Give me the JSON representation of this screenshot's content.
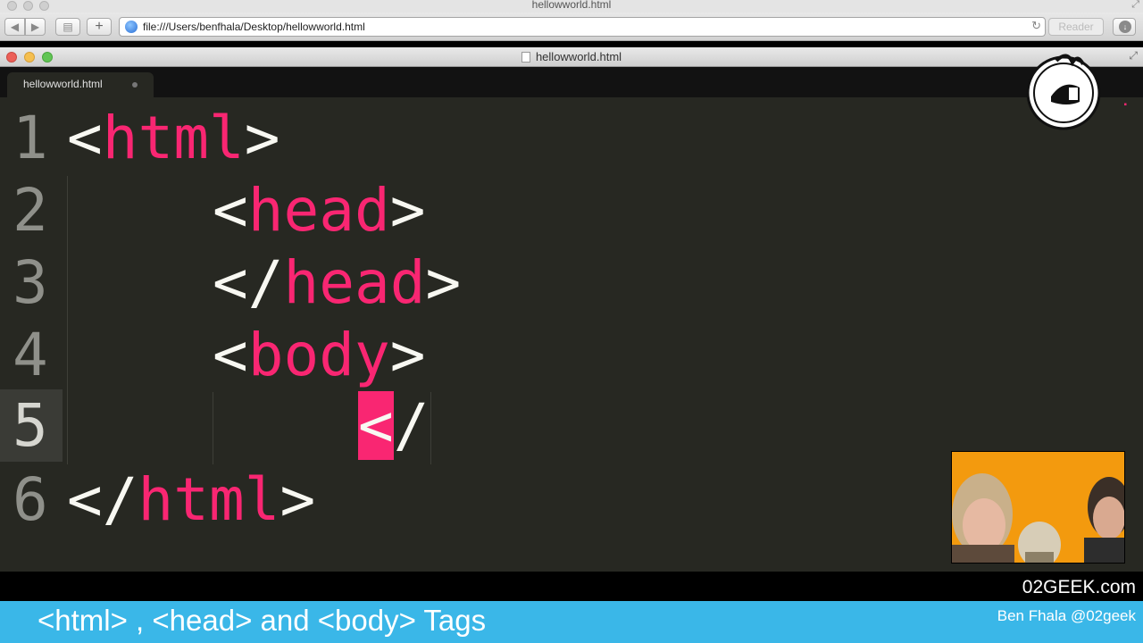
{
  "browser": {
    "title": "hellowworld.html",
    "url": "file:///Users/benfhala/Desktop/hellowworld.html",
    "reader_label": "Reader",
    "back_icon": "back-arrow-icon",
    "forward_icon": "forward-arrow-icon"
  },
  "editor": {
    "title": "hellowworld.html",
    "tab_label": "hellowworld.html"
  },
  "code": {
    "lines": [
      {
        "num": "1",
        "open": "<",
        "tag": "html",
        "close": ">"
      },
      {
        "num": "2",
        "open": "<",
        "tag": "head",
        "close": ">"
      },
      {
        "num": "3",
        "open": "</",
        "tag": "head",
        "close": ">"
      },
      {
        "num": "4",
        "open": "<",
        "tag": "body",
        "close": ">"
      },
      {
        "num": "5",
        "cursor": "<",
        "rest": "/"
      },
      {
        "num": "6",
        "open": "</",
        "tag": "html",
        "close": ">"
      }
    ],
    "current_line": "5"
  },
  "branding": {
    "site": "02GEEK.com",
    "headline": "<html> , <head> and <body>  Tags",
    "author": "Ben Fhala  @02geek"
  },
  "colors": {
    "tag": "#f92672",
    "editor_bg": "#272822",
    "banner": "#3ab7e8"
  }
}
